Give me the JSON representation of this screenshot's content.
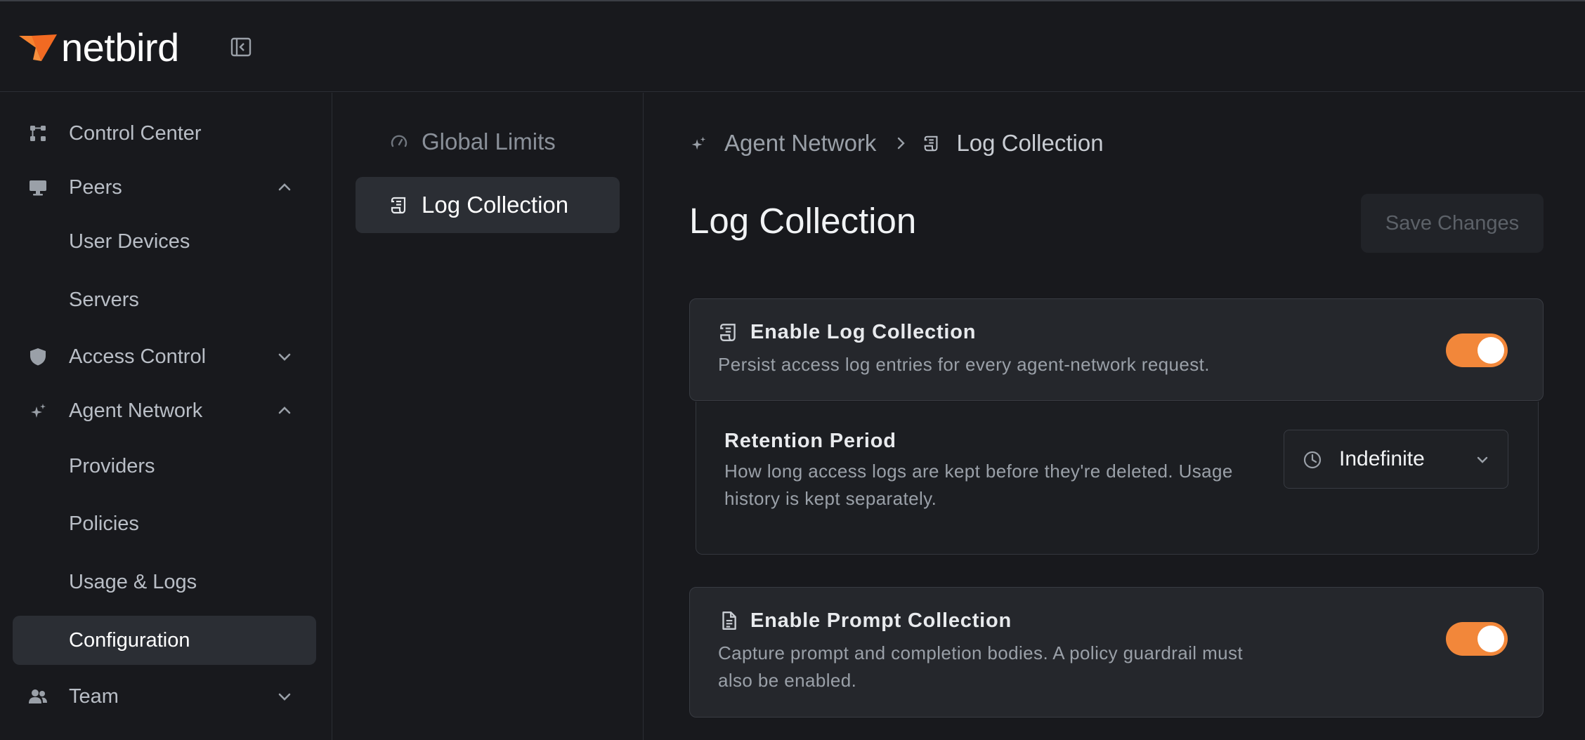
{
  "app": {
    "brand": "netbird",
    "accent_color": "#f2873a"
  },
  "sidebar": {
    "items": [
      {
        "label": "Control Center",
        "icon": "control-center-icon"
      },
      {
        "label": "Peers",
        "icon": "monitor-icon",
        "expanded": true
      },
      {
        "label": "User Devices"
      },
      {
        "label": "Servers"
      },
      {
        "label": "Access Control",
        "icon": "shield-icon",
        "expanded": false
      },
      {
        "label": "Agent Network",
        "icon": "sparkles-icon",
        "expanded": true
      },
      {
        "label": "Providers"
      },
      {
        "label": "Policies"
      },
      {
        "label": "Usage & Logs"
      },
      {
        "label": "Configuration",
        "active": true
      },
      {
        "label": "Team",
        "icon": "users-icon",
        "expanded": false
      }
    ]
  },
  "subnav": {
    "items": [
      {
        "label": "Global Limits",
        "icon": "gauge-icon"
      },
      {
        "label": "Log Collection",
        "icon": "scroll-icon",
        "active": true
      }
    ]
  },
  "breadcrumb": {
    "parent": "Agent Network",
    "current": "Log Collection"
  },
  "main": {
    "title": "Log Collection",
    "save_label": "Save Changes",
    "log_card": {
      "title": "Enable Log Collection",
      "description": "Persist access log entries for every agent-network request.",
      "enabled": true
    },
    "retention": {
      "title": "Retention Period",
      "description": "How long access logs are kept before they're deleted. Usage history is kept separately.",
      "selected": "Indefinite"
    },
    "prompt_card": {
      "title": "Enable Prompt Collection",
      "description": "Capture prompt and completion bodies. A policy guardrail must also be enabled.",
      "enabled": true
    }
  }
}
